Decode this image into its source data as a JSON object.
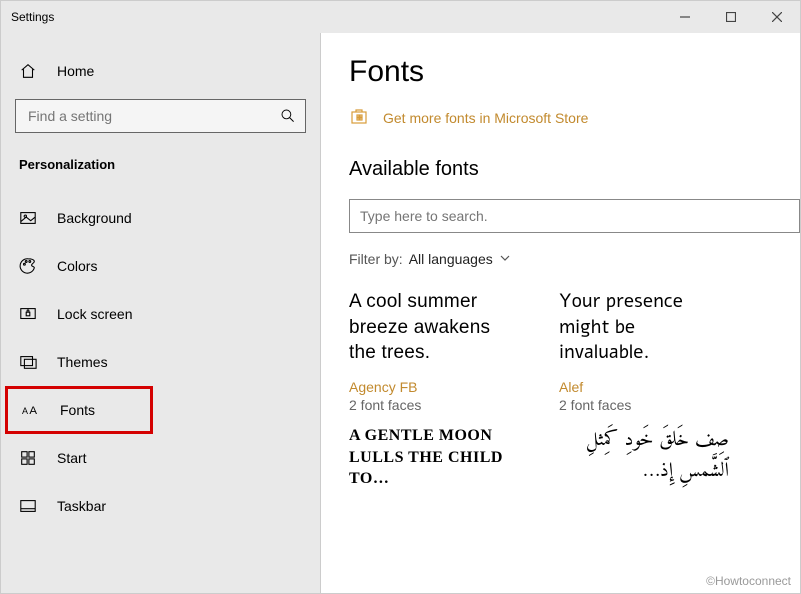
{
  "title": "Settings",
  "window_controls": {
    "minimize": "minimize",
    "maximize": "maximize",
    "close": "close"
  },
  "home_label": "Home",
  "search_placeholder": "Find a setting",
  "category": "Personalization",
  "nav": [
    {
      "icon": "image-icon",
      "label": "Background"
    },
    {
      "icon": "palette-icon",
      "label": "Colors"
    },
    {
      "icon": "lock-screen-icon",
      "label": "Lock screen"
    },
    {
      "icon": "themes-icon",
      "label": "Themes"
    },
    {
      "icon": "fonts-icon",
      "label": "Fonts"
    },
    {
      "icon": "start-icon",
      "label": "Start"
    },
    {
      "icon": "taskbar-icon",
      "label": "Taskbar"
    }
  ],
  "page": {
    "title": "Fonts",
    "store_link": "Get more fonts in Microsoft Store",
    "available_fonts_header": "Available fonts",
    "font_search_placeholder": "Type here to search.",
    "filter_label": "Filter by:",
    "filter_value": "All languages",
    "fonts": [
      {
        "preview": "A cool summer breeze awakens the trees.",
        "name": "Agency FB",
        "faces": "2 font faces",
        "cls": "agency"
      },
      {
        "preview": "Your presence might be invaluable.",
        "name": "Alef",
        "faces": "2 font faces",
        "cls": "alef"
      },
      {
        "preview": "A gentle moon lulls the child to…",
        "name": "",
        "faces": "",
        "cls": "algerian"
      },
      {
        "preview": "صِف خَلقَ خَودِ كَمِثلِ ٱلشَّمسِ إِذ…",
        "name": "",
        "faces": "",
        "cls": "arabic"
      }
    ]
  },
  "watermark": "©Howtoconnect"
}
